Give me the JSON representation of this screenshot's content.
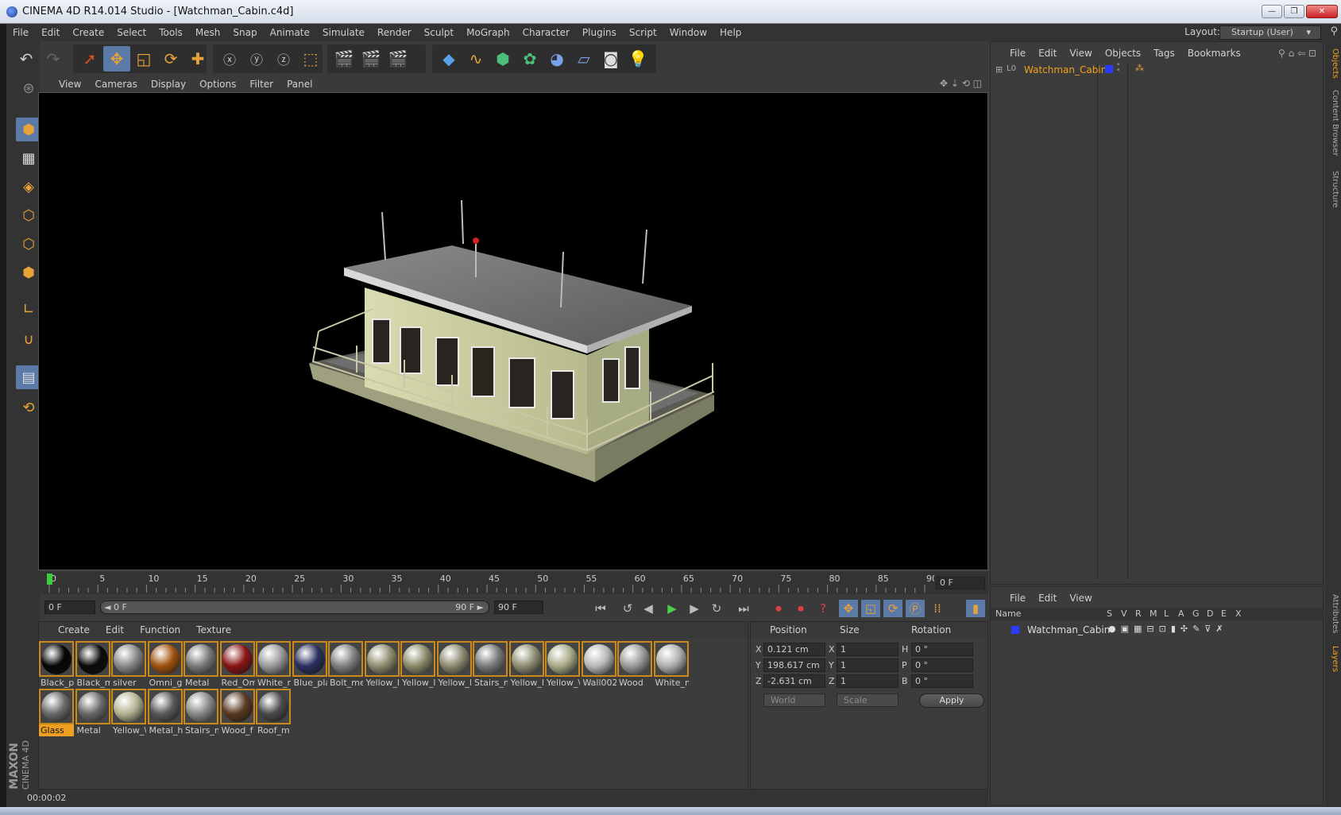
{
  "window": {
    "title": "CINEMA 4D R14.014 Studio - [Watchman_Cabin.c4d]",
    "buttons": [
      "—",
      "❐",
      "✕"
    ]
  },
  "menubar": {
    "items": [
      "File",
      "Edit",
      "Create",
      "Select",
      "Tools",
      "Mesh",
      "Snap",
      "Animate",
      "Simulate",
      "Render",
      "Sculpt",
      "MoGraph",
      "Character",
      "Plugins",
      "Script",
      "Window",
      "Help"
    ],
    "layout_label": "Layout:",
    "layout_value": "Startup (User)"
  },
  "viewport": {
    "menu": [
      "View",
      "Cameras",
      "Display",
      "Options",
      "Filter",
      "Panel"
    ]
  },
  "timeline": {
    "ticks": [
      0,
      5,
      10,
      15,
      20,
      25,
      30,
      35,
      40,
      45,
      50,
      55,
      60,
      65,
      70,
      75,
      80,
      85,
      90
    ],
    "current_frame_display": "0 F"
  },
  "transport": {
    "start": "0 F",
    "range_left": "◄ 0 F",
    "range_right": "90 F ►",
    "end": "90 F"
  },
  "materials": {
    "menu": [
      "Create",
      "Edit",
      "Function",
      "Texture"
    ],
    "row1": [
      {
        "name": "Black_pl",
        "color": "#050505"
      },
      {
        "name": "Black_m",
        "color": "#0a0a0a"
      },
      {
        "name": "silver",
        "color": "#8a8a8a"
      },
      {
        "name": "Omni_g",
        "color": "#a0520f"
      },
      {
        "name": "Metal",
        "color": "#7a7a7a"
      },
      {
        "name": "Red_Om",
        "color": "#8a1515"
      },
      {
        "name": "White_r",
        "color": "#9a9a9a"
      },
      {
        "name": "Blue_pla",
        "color": "#2a3060"
      },
      {
        "name": "Bolt_me",
        "color": "#808080"
      },
      {
        "name": "Yellow_l",
        "color": "#8f8e70"
      },
      {
        "name": "Yellow_l",
        "color": "#8a8a6a"
      },
      {
        "name": "Yellow_l",
        "color": "#8c8a70"
      },
      {
        "name": "Stairs_m",
        "color": "#7a7a7a"
      },
      {
        "name": "Yellow_l",
        "color": "#8e8e74"
      },
      {
        "name": "Yellow_\\",
        "color": "#a8aa88"
      },
      {
        "name": "Wall002",
        "color": "#b8b8b8"
      },
      {
        "name": "Wood",
        "color": "#9a9a9a"
      },
      {
        "name": "White_m",
        "color": "#b0b0b0"
      }
    ],
    "row2": [
      {
        "name": "Glass",
        "color": "#6a6a6a",
        "selected": true
      },
      {
        "name": "Metal",
        "color": "#6a6a6a"
      },
      {
        "name": "Yellow_\\",
        "color": "#b4b494"
      },
      {
        "name": "Metal_h",
        "color": "#5a5a5a"
      },
      {
        "name": "Stairs_m",
        "color": "#8a8a8a"
      },
      {
        "name": "Wood_f",
        "color": "#5a3a22"
      },
      {
        "name": "Roof_m",
        "color": "#4a4a4a"
      }
    ]
  },
  "coords": {
    "headers": [
      "Position",
      "Size",
      "Rotation"
    ],
    "rows": [
      {
        "axis": "X",
        "pos": "0.121 cm",
        "saxis": "X",
        "size": "1",
        "raxis": "H",
        "rot": "0 °"
      },
      {
        "axis": "Y",
        "pos": "198.617 cm",
        "saxis": "Y",
        "size": "1",
        "raxis": "P",
        "rot": "0 °"
      },
      {
        "axis": "Z",
        "pos": "-2.631 cm",
        "saxis": "Z",
        "size": "1",
        "raxis": "B",
        "rot": "0 °"
      }
    ],
    "mode1": "World",
    "mode2": "Scale",
    "apply": "Apply"
  },
  "status": {
    "time": "00:00:02"
  },
  "objects": {
    "menu": [
      "File",
      "Edit",
      "View",
      "Objects",
      "Tags",
      "Bookmarks"
    ],
    "items": [
      {
        "name": "Watchman_Cabin"
      }
    ]
  },
  "layers": {
    "menu": [
      "File",
      "Edit",
      "View"
    ],
    "columns": [
      "Name",
      "S",
      "V",
      "R",
      "M",
      "L",
      "A",
      "G",
      "D",
      "E",
      "X"
    ],
    "items": [
      {
        "name": "Watchman_Cabin",
        "color": "#2a3aff"
      }
    ]
  },
  "sidetabs": {
    "top": [
      "Objects",
      "Content Browser",
      "Structure"
    ],
    "bottom": [
      "Attributes",
      "Layers"
    ]
  },
  "branding": {
    "line1": "MAXON",
    "line2": "CINEMA 4D"
  },
  "colors": {
    "accent": "#f0a020",
    "selection": "#5b7aa8"
  }
}
